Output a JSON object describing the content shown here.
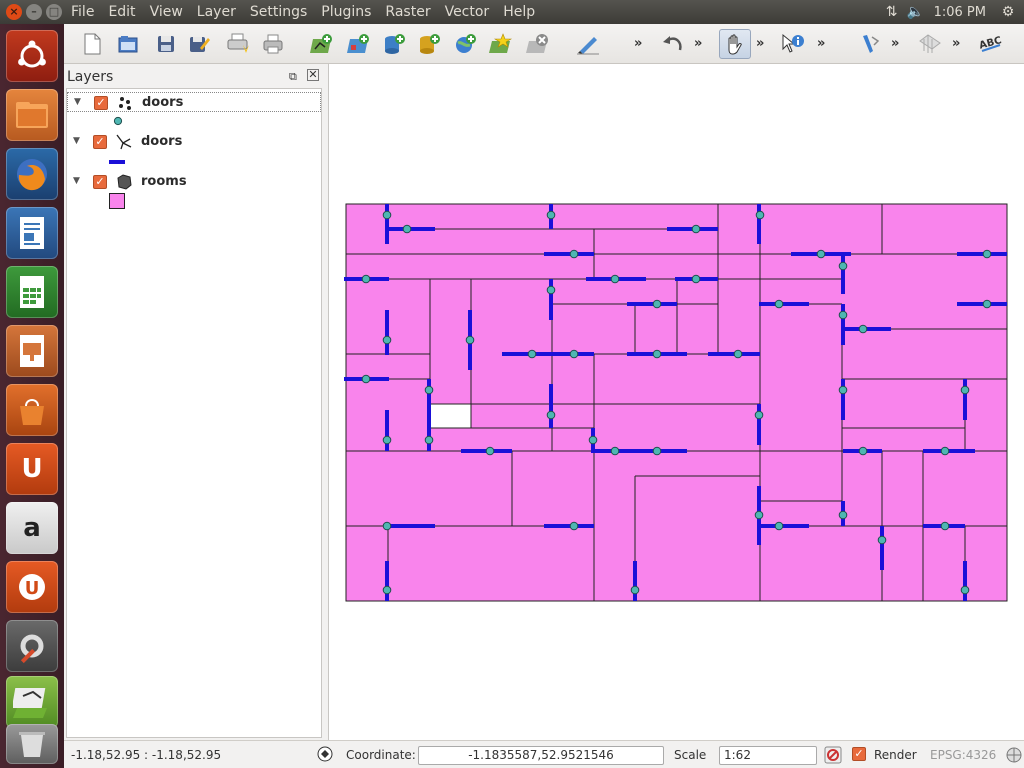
{
  "window": {
    "close": "×",
    "minimize": "–",
    "maximize": "□"
  },
  "menubar": {
    "items": [
      "File",
      "Edit",
      "View",
      "Layer",
      "Settings",
      "Plugins",
      "Raster",
      "Vector",
      "Help"
    ]
  },
  "tray": {
    "clock": "1:06 PM",
    "network_icon": "⇅",
    "volume_icon": "🔈",
    "settings_icon": "⚙"
  },
  "launcher": {
    "items": [
      "dash",
      "files",
      "firefox",
      "writer",
      "calc",
      "impress",
      "software-center",
      "ubuntu-one",
      "amazon",
      "ubuntu-one-music",
      "system-settings",
      "qgis",
      "trash"
    ]
  },
  "toolbar": {
    "more": "»"
  },
  "layers_panel": {
    "title": "Layers",
    "float_icon": "⧉",
    "close_icon": "✕",
    "layers": [
      {
        "name": "doors",
        "geometry": "point",
        "checked": true
      },
      {
        "name": "doors",
        "geometry": "line",
        "checked": true
      },
      {
        "name": "rooms",
        "geometry": "polygon",
        "checked": true
      }
    ]
  },
  "colors": {
    "room_fill": "#f984ec",
    "door_line": "#1a10d8",
    "door_point": "#4fb6b2"
  },
  "statusbar": {
    "extents": "-1.18,52.95 : -1.18,52.95",
    "coordinate_label": "Coordinate:",
    "coordinate_value": "-1.1835587,52.9521546",
    "scale_label": "Scale",
    "scale_value": "1:62",
    "render_label": "Render",
    "render_checked": true,
    "crs": "EPSG:4326"
  }
}
